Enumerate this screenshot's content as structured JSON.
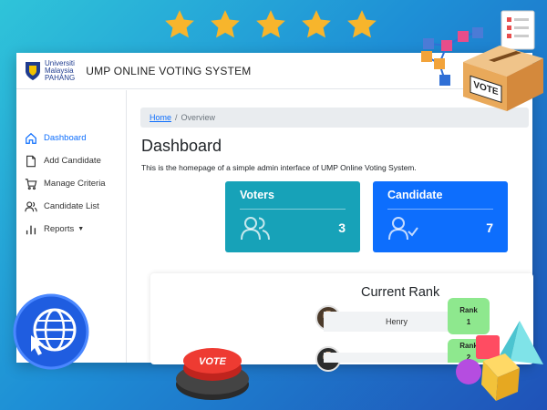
{
  "app": {
    "logo_lines": [
      "Universiti",
      "Malaysia",
      "PAHANG"
    ],
    "title": "UMP ONLINE VOTING SYSTEM"
  },
  "sidebar": {
    "items": [
      {
        "label": "Dashboard",
        "icon": "home-icon",
        "active": true
      },
      {
        "label": "Add Candidate",
        "icon": "document-icon",
        "active": false
      },
      {
        "label": "Manage Criteria",
        "icon": "cart-icon",
        "active": false
      },
      {
        "label": "Candidate List",
        "icon": "users-icon",
        "active": false
      },
      {
        "label": "Reports",
        "icon": "bar-chart-icon",
        "active": false,
        "has_dropdown": true
      }
    ]
  },
  "breadcrumb": {
    "home": "Home",
    "separator": "/",
    "current": "Overview"
  },
  "page": {
    "title": "Dashboard",
    "description": "This is the homepage of a simple admin interface of UMP Online Voting System."
  },
  "cards": [
    {
      "title": "Voters",
      "count": "3",
      "icon": "users-icon",
      "color": "#17a2b8"
    },
    {
      "title": "Candidate",
      "count": "7",
      "icon": "user-check-icon",
      "color": "#0d6efd"
    }
  ],
  "rank": {
    "title": "Current Rank",
    "rows": [
      {
        "name": "Henry",
        "rank_label": "Rank",
        "rank": "1"
      },
      {
        "name": "",
        "rank_label": "Rank",
        "rank": "2"
      }
    ]
  },
  "decor": {
    "star_count": 5,
    "ballot_box_label": "VOTE",
    "vote_button_label": "VOTE",
    "star_color": "#f7b52c"
  }
}
